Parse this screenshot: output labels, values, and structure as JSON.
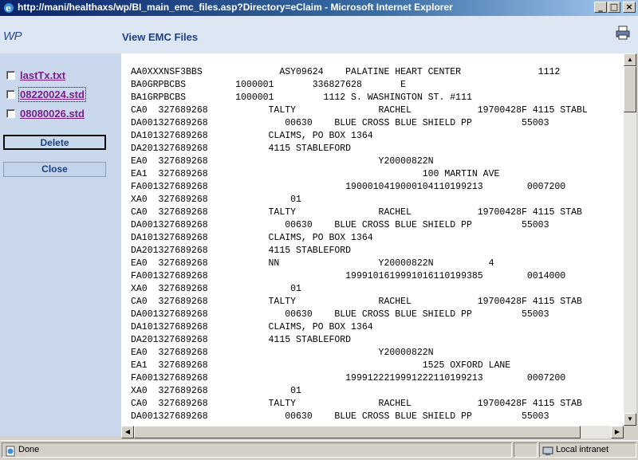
{
  "window": {
    "title": "http://mani/healthaxs/wp/BI_main_emc_files.asp?Directory=eClaim - Microsoft Internet Explorer",
    "controls": {
      "minimize": "_",
      "maximize": "□",
      "close": "×"
    }
  },
  "header": {
    "logo": "WP",
    "title": "View EMC Files",
    "print_icon": "printer-icon"
  },
  "sidebar": {
    "files": [
      {
        "name": "lastTx.txt",
        "checked": false
      },
      {
        "name": "08220024.std",
        "checked": false
      },
      {
        "name": "08080026.std",
        "checked": false
      }
    ],
    "delete_label": "Delete",
    "close_label": "Close"
  },
  "content": {
    "lines": [
      "AA0XXXNSF3BBS              ASY09624    PALATINE HEART CENTER              1112",
      "BA0GRPBCBS         1000001       336827628       E",
      "BA1GRPBCBS         1000001         1112 S. WASHINGTON ST. #111",
      "CA0  327689268           TALTY               RACHEL            19700428F 4115 STABL",
      "DA00132768926 8              00630    BLUE CROSS BLUE SHIELD PP         55003",
      "DA101327689268           CLAIMS, PO BOX 1364",
      "DA201327689268           4115 STABLEFORD",
      "EA0  327689268                               Y20000822N",
      "EA1  327689268                                       100 MARTIN AVE",
      "FA00132768926 8                         1900010419000104110199213        0007200",
      "XA0  327689268               01",
      "CA0  327689268           TALTY               RACHEL            19700428F 4115 STAB",
      "DA00132768926 8              00630    BLUE CROSS BLUE SHIELD PP         55003",
      "DA101327689268           CLAIMS, PO BOX 1364",
      "DA201327689268           4115 STABLEFORD",
      "EA0  327689268           NN                  Y20000822N          4",
      "FA00132768926 8                         1999101619991016110199385        0014000",
      "XA0  327689268               01",
      "CA0  327689268           TALTY               RACHEL            19700428F 4115 STAB",
      "DA00132768926 8              00630    BLUE CROSS BLUE SHIELD PP         55003",
      "DA101327689268           CLAIMS, PO BOX 1364",
      "DA201327689268           4115 STABLEFORD",
      "EA0  327689268                               Y20000822N",
      "EA1  327689268                                       1525 OXFORD LANE",
      "FA00132768926 8                         1999122219991222110199213        0007200",
      "XA0  327689268               01",
      "CA0  327689268           TALTY               RACHEL            19700428F 4115 STAB",
      "DA00132768926 8              00630    BLUE CROSS BLUE SHIELD PP         55003"
    ]
  },
  "statusbar": {
    "status": "Done",
    "zone": "Local intranet"
  }
}
